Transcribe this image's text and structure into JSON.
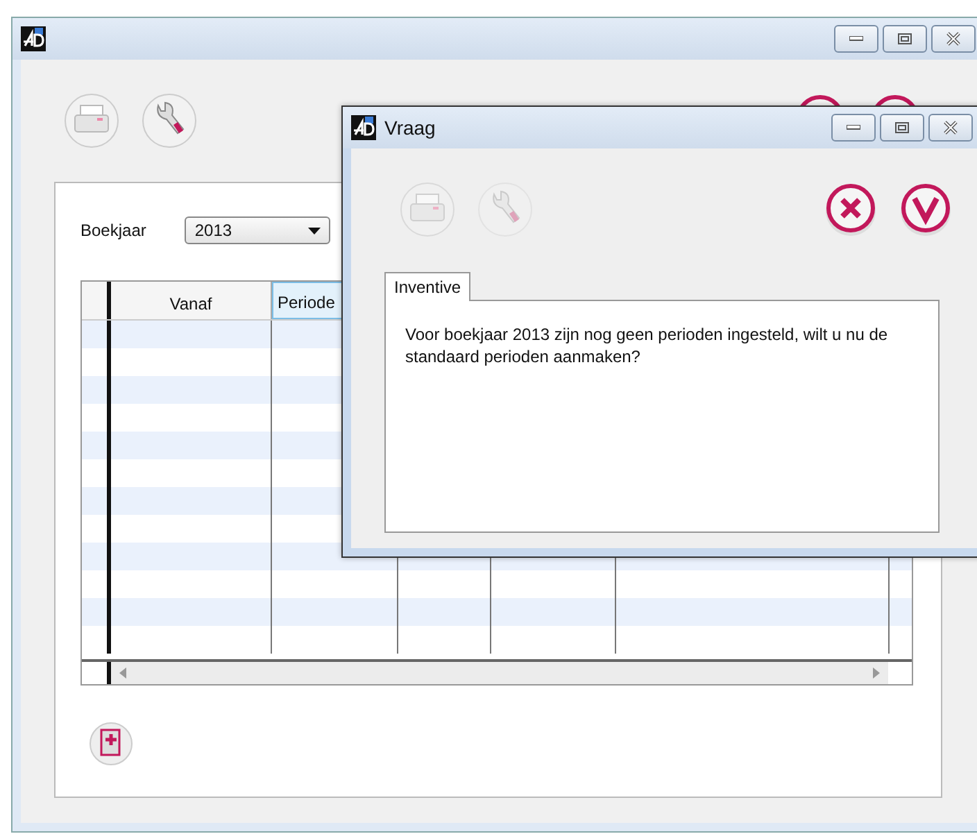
{
  "main_window": {
    "fiscal_year": {
      "label": "Boekjaar",
      "value": "2013"
    },
    "table": {
      "columns": [
        {
          "label": "Vanaf",
          "sorted": false
        },
        {
          "label": "Periode",
          "sorted": true
        }
      ]
    }
  },
  "dialog": {
    "title": "Vraag",
    "tabs": [
      {
        "label": "Inventive",
        "selected": true
      }
    ],
    "message": "Voor boekjaar 2013 zijn nog geen perioden ingesteld, wilt u nu de standaard perioden aanmaken?"
  }
}
